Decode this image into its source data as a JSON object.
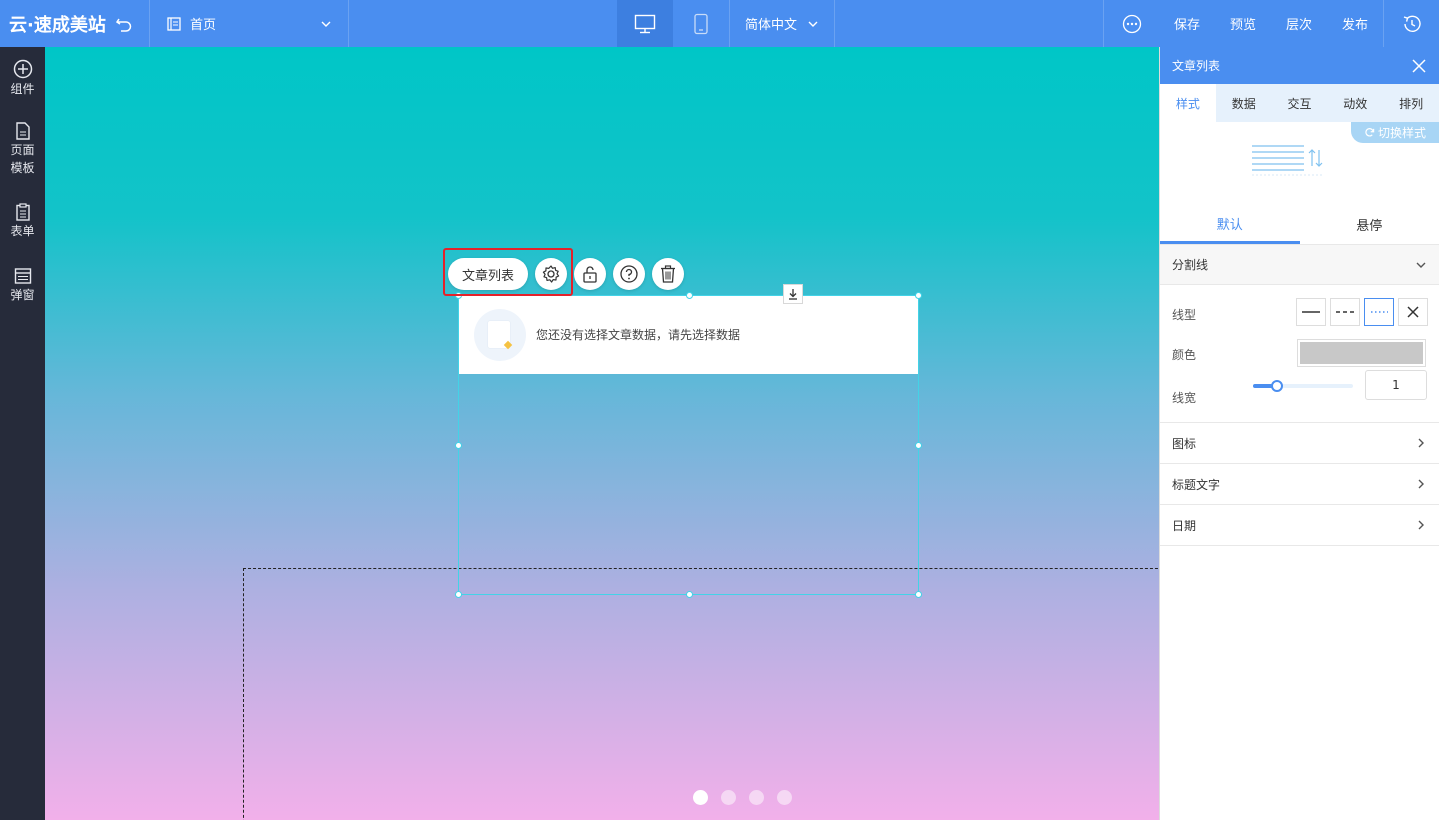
{
  "topbar": {
    "logo": "云·速成美站",
    "page": "首页",
    "language": "简体中文",
    "buttons": {
      "save": "保存",
      "preview": "预览",
      "layers": "层次",
      "publish": "发布"
    }
  },
  "sidebar": {
    "items": [
      {
        "label": "组件"
      },
      {
        "label": "页面模板"
      },
      {
        "label": "表单"
      },
      {
        "label": "弹窗"
      }
    ]
  },
  "canvas": {
    "floating_toolbar": {
      "label": "文章列表"
    },
    "widget_message": "您还没有选择文章数据，请先选择数据",
    "slide_count": 4,
    "active_slide": 1
  },
  "panel": {
    "title": "文章列表",
    "tabs": [
      "样式",
      "数据",
      "交互",
      "动效",
      "排列"
    ],
    "switch_style": "切换样式",
    "state_tabs": [
      "默认",
      "悬停"
    ],
    "divider_section": {
      "title": "分割线",
      "line_type_label": "线型",
      "color_label": "颜色",
      "color_value": "#c8c8c8",
      "width_label": "线宽",
      "width_value": "1"
    },
    "sections": [
      "图标",
      "标题文字",
      "日期"
    ]
  },
  "colors": {
    "topbar": "#4a8ef0",
    "sidebar": "#262b3a",
    "highlight": "#e5212a",
    "selection": "#43d3e7"
  }
}
